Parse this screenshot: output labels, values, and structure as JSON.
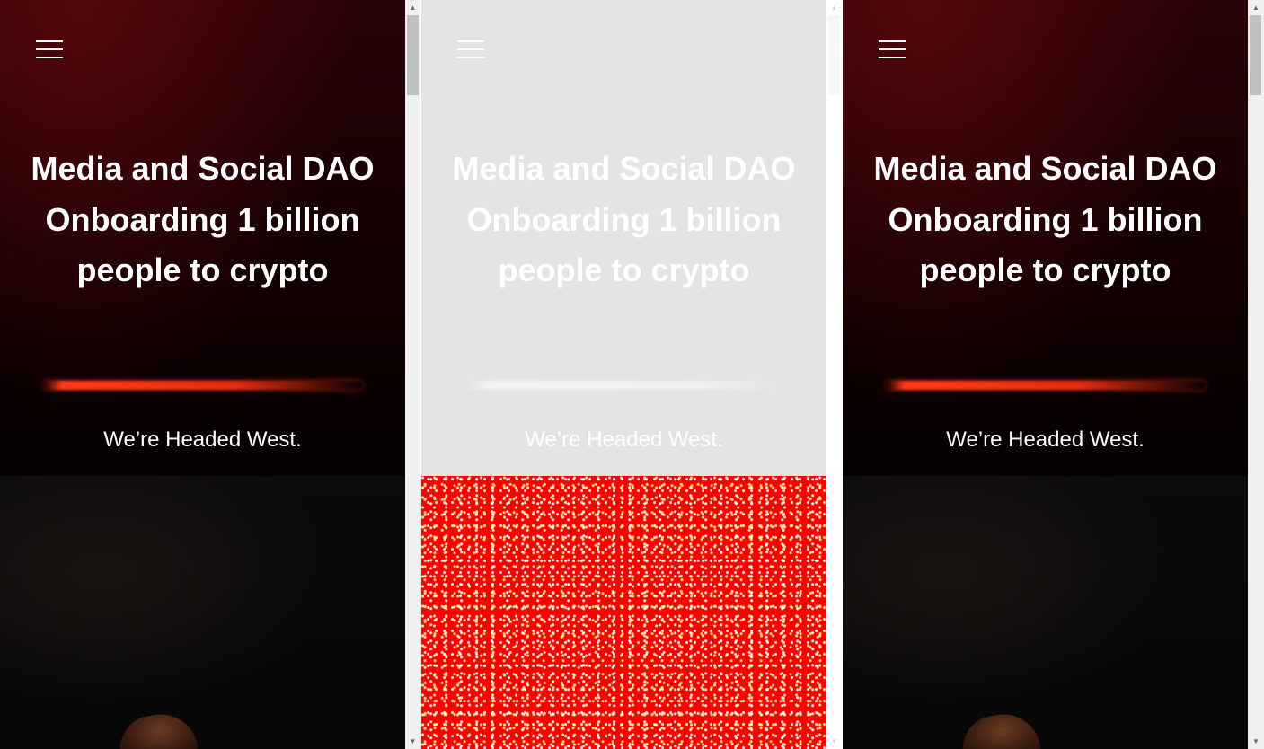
{
  "panels": [
    {
      "headline": "Media and Social DAO Onboarding 1 billion people to crypto",
      "tagline": "We’re Headed West."
    },
    {
      "headline": "Media and Social DAO Onboarding 1 billion people to crypto",
      "tagline": "We’re Headed West."
    },
    {
      "headline": "Media and Social DAO Onboarding 1 billion people to crypto",
      "tagline": "We’re Headed West."
    }
  ],
  "icons": {
    "menu": "hamburger-menu-icon",
    "scroll_up": "▲",
    "scroll_down": "▼"
  },
  "colors": {
    "hero_dark": "#160103",
    "accent_line": "#e42d12",
    "faded_overlay": "#e4e4e4",
    "noise_red": "#ff0000",
    "text": "#ffffff"
  }
}
